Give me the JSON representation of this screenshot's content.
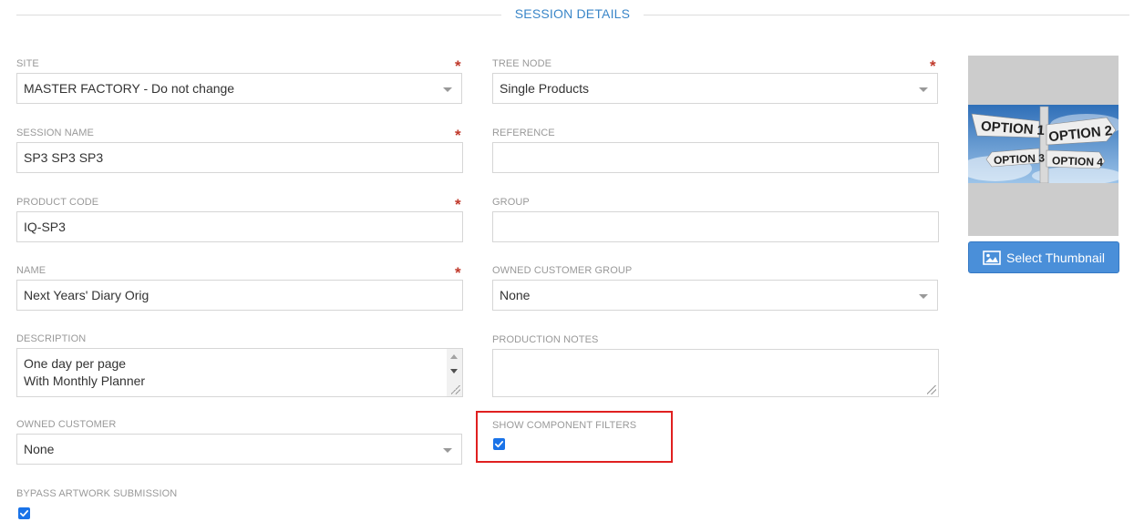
{
  "section": {
    "title": "SESSION DETAILS"
  },
  "site": {
    "label": "SITE",
    "value": "MASTER FACTORY - Do not change",
    "required": "*"
  },
  "tree_node": {
    "label": "TREE NODE",
    "value": "Single Products",
    "required": "*"
  },
  "session_name": {
    "label": "SESSION NAME",
    "value": "SP3 SP3 SP3",
    "required": "*"
  },
  "reference": {
    "label": "REFERENCE",
    "value": ""
  },
  "product_code": {
    "label": "PRODUCT CODE",
    "value": "IQ-SP3",
    "required": "*"
  },
  "group": {
    "label": "GROUP",
    "value": ""
  },
  "name": {
    "label": "NAME",
    "value": "Next Years' Diary Orig",
    "required": "*"
  },
  "owned_customer_group": {
    "label": "OWNED CUSTOMER GROUP",
    "value": "None"
  },
  "description": {
    "label": "DESCRIPTION",
    "lines": [
      "One day per page",
      "With Monthly Planner"
    ]
  },
  "production_notes": {
    "label": "PRODUCTION NOTES",
    "value": ""
  },
  "owned_customer": {
    "label": "OWNED CUSTOMER",
    "value": "None"
  },
  "show_component_filters": {
    "label": "SHOW COMPONENT FILTERS",
    "checked": true
  },
  "bypass_artwork_submission": {
    "label": "BYPASS ARTWORK SUBMISSION",
    "checked": true
  },
  "thumbnail": {
    "button_label": "Select Thumbnail",
    "signs": [
      "OPTION 1",
      "OPTION 2",
      "OPTION 3",
      "OPTION 4"
    ]
  },
  "colors": {
    "accent": "#3a86c8",
    "button": "#4a8fd9",
    "required": "#c0392b",
    "highlight": "#e02020"
  }
}
